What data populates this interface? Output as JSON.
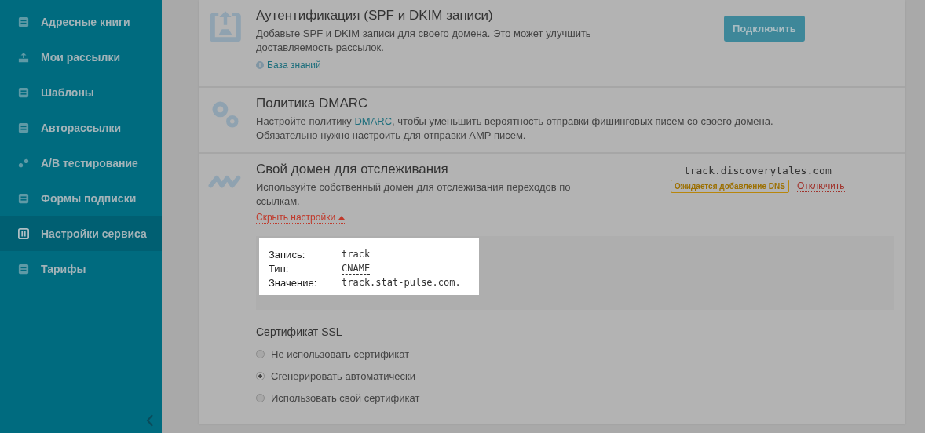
{
  "sidebar": {
    "items": [
      {
        "label": "Адресные книги",
        "selected": false
      },
      {
        "label": "Мои рассылки",
        "selected": false
      },
      {
        "label": "Шаблоны",
        "selected": false
      },
      {
        "label": "Авторассылки",
        "selected": false
      },
      {
        "label": "A/B тестирование",
        "selected": false
      },
      {
        "label": "Формы подписки",
        "selected": false
      },
      {
        "label": "Настройки сервиса",
        "selected": true
      },
      {
        "label": "Тарифы",
        "selected": false
      }
    ]
  },
  "sections": [
    {
      "kind": "auth",
      "title": "Аутентификация (SPF и DKIM записи)",
      "description": "Добавьте SPF и DKIM записи для своего домена. Это может улучшить доставляемость рассылок.",
      "help_link": "База знаний",
      "button": "Подключить"
    },
    {
      "kind": "dmarc",
      "title": "Политика DMARC",
      "description_before": "Настройте политику ",
      "description_link": "DMARC",
      "description_after": ", чтобы уменьшить вероятность отправки фишинговых писем со своего домена.",
      "description_line2": "Обязательно нужно настроить для отправки AMP писем."
    },
    {
      "kind": "tracking",
      "title": "Свой домен для отслеживания",
      "description": "Используйте собственный домен для отслеживания переходов по ссылкам.",
      "toggle_link": "Скрыть настройки",
      "domain": "track.discoverytales.com",
      "status_badge": "Ожидается добавление DNS",
      "disconnect_link": "Отключить",
      "dns": [
        {
          "label": "Запись:",
          "value": "track",
          "underlined": true
        },
        {
          "label": "Тип:",
          "value": "CNAME",
          "underlined": true
        },
        {
          "label": "Значение:",
          "value": "track.stat-pulse.com.",
          "underlined": false
        }
      ],
      "ssl_title": "Сертификат SSL",
      "ssl_options": [
        {
          "label": "Не использовать сертификат",
          "selected": false
        },
        {
          "label": "Сгенерировать автоматически",
          "selected": true
        },
        {
          "label": "Использовать свой сертификат",
          "selected": false
        }
      ]
    }
  ]
}
